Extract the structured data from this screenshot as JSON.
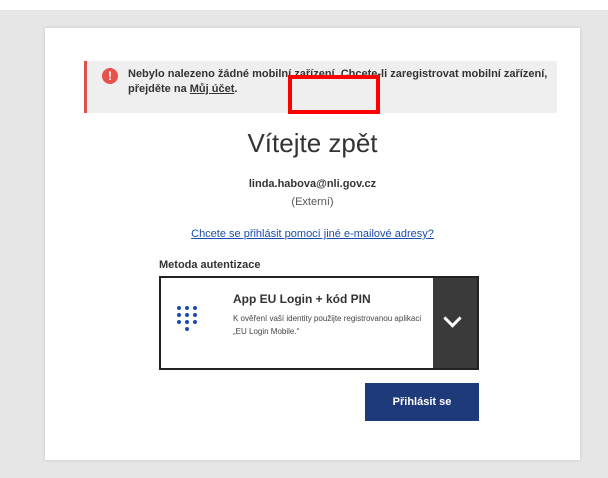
{
  "header": {
    "partial_text": "̄̄  ̄  ̄"
  },
  "alert": {
    "text_before": "Nebylo nalezeno žádné mobilní zařízení. Chcete-li zaregistrovat mobilní zařízení, přejděte na ",
    "link": "Můj účet",
    "text_after": ".",
    "icon": "exclamation-icon",
    "accent_color": "#e5534b"
  },
  "welcome": "Vítejte zpět",
  "user": {
    "email": "linda.habova@nli.gov.cz",
    "type": "(Externí)"
  },
  "alternate_login_link": "Chcete se přihlásit pomocí jiné e-mailové adresy?",
  "method": {
    "label": "Metoda autentizace",
    "selected_title": "App EU Login + kód PIN",
    "selected_description": "K ověření vaší identity použijte registrovanou aplikaci „EU Login Mobile.“",
    "icon": "keypad-icon"
  },
  "login_button": "Přihlásit se",
  "colors": {
    "primary": "#1f3a7a",
    "link": "#1a4cae",
    "highlight": "#ff0000"
  }
}
